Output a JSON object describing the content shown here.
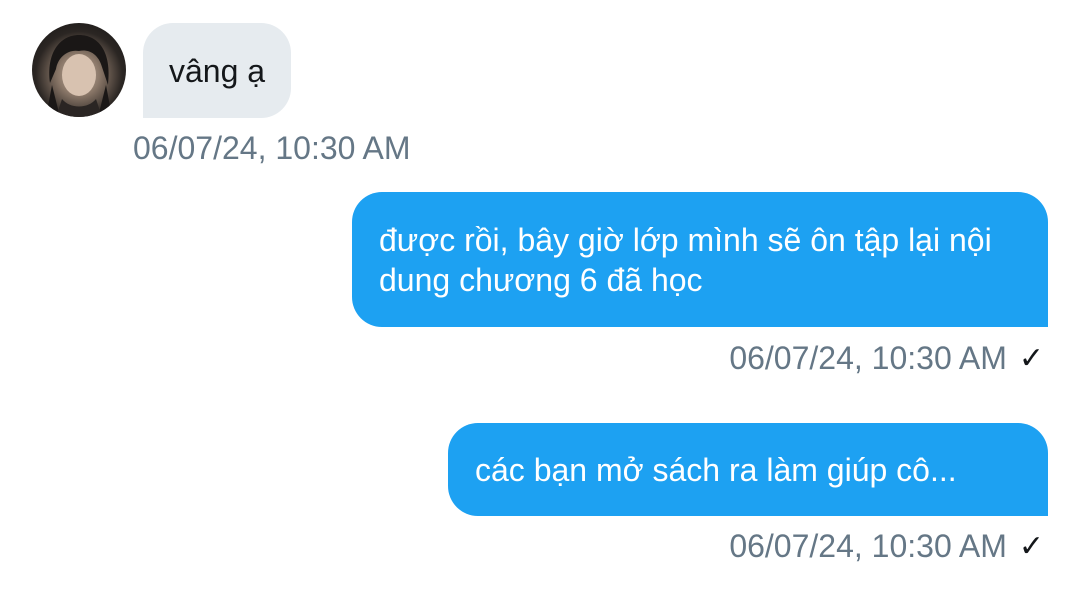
{
  "messages": [
    {
      "direction": "incoming",
      "text": "vâng ạ",
      "timestamp": "06/07/24, 10:30 AM"
    },
    {
      "direction": "outgoing",
      "text": "được rồi, bây giờ lớp mình sẽ ôn tập lại nội dung chương 6 đã học",
      "timestamp": "06/07/24, 10:30 AM",
      "status_icon": "check-icon"
    },
    {
      "direction": "outgoing",
      "text": "các bạn mở sách ra làm giúp cô...",
      "timestamp": "06/07/24, 10:30 AM",
      "status_icon": "check-icon"
    }
  ],
  "icons": {
    "check": "✓"
  },
  "colors": {
    "outgoing_bubble": "#1da1f2",
    "incoming_bubble": "#e6ebef",
    "timestamp": "#657786"
  }
}
